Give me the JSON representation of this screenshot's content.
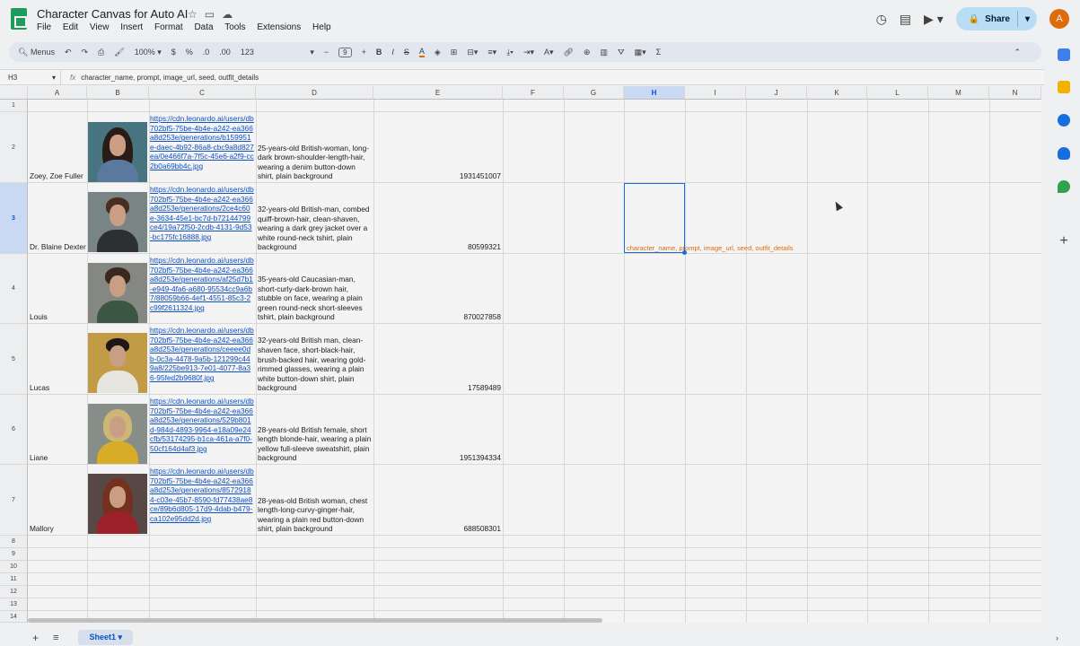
{
  "doc": {
    "title": "Character Canvas for Auto AI"
  },
  "menu": [
    "File",
    "Edit",
    "View",
    "Insert",
    "Format",
    "Data",
    "Tools",
    "Extensions",
    "Help"
  ],
  "share": {
    "label": "Share"
  },
  "avatar": {
    "letter": "A",
    "color": "#e8710a"
  },
  "toolbar": {
    "menus_label": "Menus",
    "zoom": "100%",
    "currency": "$",
    "percent": "%",
    "dec_decrease": ".0",
    "dec_increase": ".00",
    "number_format": "123",
    "font_size": "9"
  },
  "formula_bar": {
    "cell_ref": "H3",
    "value": "character_name, prompt, image_url, seed, outfit_details"
  },
  "columns": [
    "A",
    "B",
    "C",
    "D",
    "E",
    "F",
    "G",
    "H",
    "I",
    "J",
    "K",
    "L",
    "M",
    "N"
  ],
  "rows": [
    {
      "num": "1"
    },
    {
      "num": "2",
      "name": "Zoey, Zoe Fuller",
      "url": "https://cdn.leonardo.ai/users/db702bf5-75be-4b4e-a242-ea366a8d253e/generations/b159951e-daec-4b92-86a8-cbc9a8d827ea/0e466f7a-7f5c-45e6-a2f9-cc2b0a69bb4c.jpg",
      "prompt": "25-years-old British-woman, long-dark brown-shoulder-length-hair, wearing a denim button-down shirt, plain background",
      "seed": "1931451007"
    },
    {
      "num": "3",
      "name": "Dr. Blaine Dexter",
      "url": "https://cdn.leonardo.ai/users/db702bf5-75be-4b4e-a242-ea366a8d253e/generations/2ce4c60e-3634-45e1-bc7d-b72144799ce4/19a72f50-2cdb-4131-9d53-bc175fc16888.jpg",
      "prompt": "32-years-old British-man, combed quiff-brown-hair, clean-shaven, wearing a dark grey jacket over a white round-neck tshirt, plain background",
      "seed": "80599321"
    },
    {
      "num": "4",
      "name": "Louis",
      "url": "https://cdn.leonardo.ai/users/db702bf5-75be-4b4e-a242-ea366a8d253e/generations/af25d7b1-e949-4fa6-a680-95534cc9a6b7/88059b66-4ef1-4551-85c3-2c99f2611324.jpg",
      "prompt": "35-years-old Caucasian-man, short-curly-dark-brown hair, stubble on face, wearing a plain green round-neck short-sleeves tshirt, plain background",
      "seed": "870027858"
    },
    {
      "num": "5",
      "name": "Lucas",
      "url": "https://cdn.leonardo.ai/users/db702bf5-75be-4b4e-a242-ea366a8d253e/generations/ceeee0db-0c3a-4478-9a5b-121299c449a8/225be913-7e01-4077-8a36-95fed2b9680f.jpg",
      "prompt": "32-years-old British man, clean-shaven face, short-black-hair, brush-backed hair, wearing gold-rimmed glasses, wearing a plain white button-down shirt, plain background",
      "seed": "17589489"
    },
    {
      "num": "6",
      "name": "Liane",
      "url": "https://cdn.leonardo.ai/users/db702bf5-75be-4b4e-a242-ea366a8d253e/generations/529b801d-984d-4893-9964-e18a09e24cfb/53174295-b1ca-461a-a7f0-50cf164d4af3.jpg",
      "prompt": "28-years-old British female, short length blonde-hair, wearing a plain yellow full-sleeve sweatshirt, plain background",
      "seed": "1951394334"
    },
    {
      "num": "7",
      "name": "Mallory",
      "url": "https://cdn.leonardo.ai/users/db702bf5-75be-4b4e-a242-ea366a8d253e/generations/85729184-c03e-45b7-8590-fd77438ae8ce/89b6d805-17d9-4dab-b479-ca102e95dd2d.jpg",
      "prompt": "28-yeas-old British woman, chest length-long-curvy-ginger-hair, wearing a plain red button-down shirt, plain background",
      "seed": "688508301"
    },
    {
      "num": "8"
    },
    {
      "num": "9"
    },
    {
      "num": "10"
    },
    {
      "num": "11"
    },
    {
      "num": "12"
    },
    {
      "num": "13"
    },
    {
      "num": "14"
    }
  ],
  "h3_overflow": "character_name, prompt, image_url, seed, outfit_details",
  "sheet_tab": {
    "label": "Sheet1"
  }
}
